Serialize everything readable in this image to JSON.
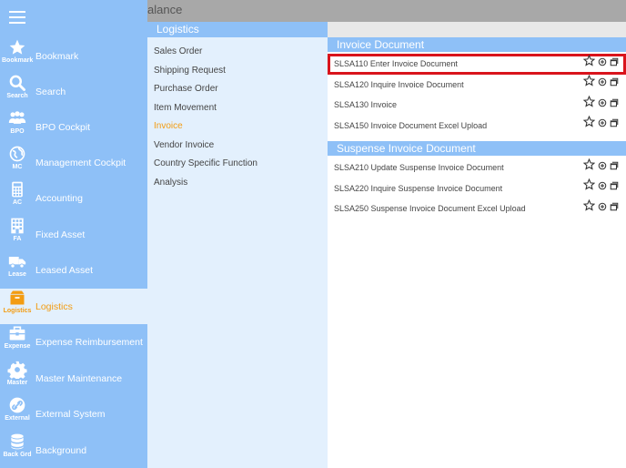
{
  "topbar": {
    "title": "alance"
  },
  "sidebar": {
    "items": [
      {
        "label": "Bookmark",
        "abbr": "Bookmark",
        "icon": "star-icon"
      },
      {
        "label": "Search",
        "abbr": "Search",
        "icon": "search-icon"
      },
      {
        "label": "BPO Cockpit",
        "abbr": "BPO",
        "icon": "people-icon"
      },
      {
        "label": "Management Cockpit",
        "abbr": "MC",
        "icon": "globe-icon"
      },
      {
        "label": "Accounting",
        "abbr": "AC",
        "icon": "calculator-icon"
      },
      {
        "label": "Fixed Asset",
        "abbr": "FA",
        "icon": "building-icon"
      },
      {
        "label": "Leased Asset",
        "abbr": "Lease",
        "icon": "truck-icon"
      },
      {
        "label": "Logistics",
        "abbr": "Logistics",
        "icon": "box-icon"
      },
      {
        "label": "Expense Reimbursement",
        "abbr": "Expense",
        "icon": "briefcase-icon"
      },
      {
        "label": "Master Maintenance",
        "abbr": "Master",
        "icon": "gear-icon"
      },
      {
        "label": "External System",
        "abbr": "External",
        "icon": "link-icon"
      },
      {
        "label": "Background",
        "abbr": "Back Grd",
        "icon": "database-icon"
      }
    ]
  },
  "submenu": {
    "header": "Logistics",
    "items": [
      "Sales Order",
      "Shipping Request",
      "Purchase Order",
      "Item Movement",
      "Invoice",
      "Vendor Invoice",
      "Country Specific Function",
      "Analysis"
    ]
  },
  "content": {
    "sections": [
      {
        "title": "Invoice Document",
        "rows": [
          "SLSA110 Enter Invoice Document",
          "SLSA120 Inquire Invoice Document",
          "SLSA130 Invoice",
          "SLSA150 Invoice Document Excel Upload"
        ]
      },
      {
        "title": "Suspense Invoice Document",
        "rows": [
          "SLSA210 Update Suspense Invoice Document",
          "SLSA220 Inquire Suspense Invoice Document",
          "SLSA250 Suspense Invoice Document Excel Upload"
        ]
      }
    ]
  },
  "colors": {
    "sidebar": "#8ec0f7",
    "active_bg": "#e3f0fd",
    "accent": "#f39c12",
    "highlight": "#d9141c"
  }
}
